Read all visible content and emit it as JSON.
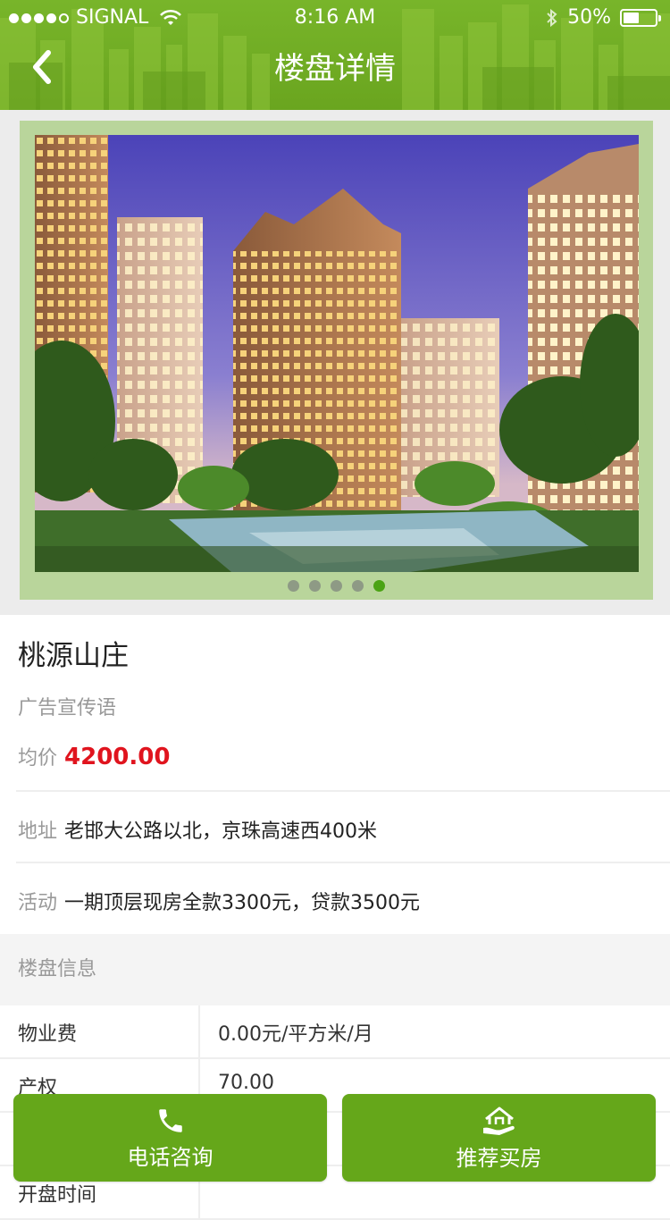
{
  "status_bar": {
    "carrier": "SIGNAL",
    "time": "8:16 AM",
    "battery": "50%",
    "battery_level": 0.5
  },
  "header": {
    "title": "楼盘详情",
    "back_icon": "chevron-left-icon"
  },
  "carousel": {
    "page_count": 5,
    "active_index": 4
  },
  "estate": {
    "name": "桃源山庄",
    "slogan": "广告宣传语",
    "price_label": "均价",
    "price_value": "4200.00",
    "address_label": "地址",
    "address_value": "老邯大公路以北，京珠高速西400米",
    "activity_label": "活动",
    "activity_value": "一期顶层现房全款3300元，贷款3500元"
  },
  "info_section": {
    "title": "楼盘信息",
    "rows": [
      {
        "label": "物业费",
        "value": "0.00元/平方米/月"
      },
      {
        "label": "产权",
        "value": "70.00"
      },
      {
        "label": "",
        "value": ""
      },
      {
        "label": "开盘时间",
        "value": ""
      }
    ]
  },
  "actions": {
    "call_label": "电话咨询",
    "recommend_label": "推荐买房"
  },
  "colors": {
    "primary_green": "#65a71a",
    "price_red": "#e0141e",
    "pager_active": "#4ba314"
  }
}
